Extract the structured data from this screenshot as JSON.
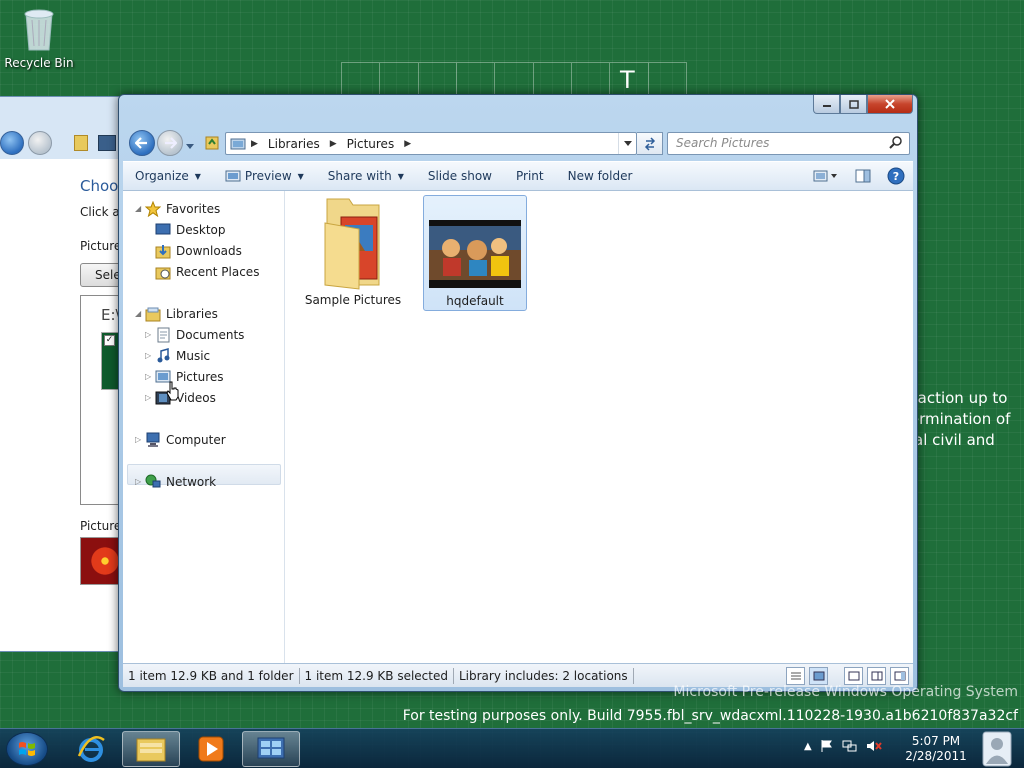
{
  "desktop": {
    "recycle_bin_label": "Recycle Bin",
    "grid_letter": "T",
    "right_text": [
      "y action up to",
      "termination of",
      "tial civil and"
    ],
    "build_line1": "Microsoft Pre-release Windows Operating System",
    "build_line2": "For testing purposes only. Build 7955.fbl_srv_wdacxml.110228-1930.a1b6210f837a32cf"
  },
  "bg_window": {
    "title": "Choos",
    "click_text": "Click a p",
    "picture_loc": "Picture l",
    "select_btn": "Sele",
    "drive_text": "E:\\U",
    "checkbox": "✓",
    "picture_pos": "Picture p"
  },
  "explorer": {
    "breadcrumbs": [
      "Libraries",
      "Pictures"
    ],
    "search_placeholder": "Search Pictures",
    "toolbar": {
      "organize": "Organize",
      "preview": "Preview",
      "share_with": "Share with",
      "slide_show": "Slide show",
      "print": "Print",
      "new_folder": "New folder"
    },
    "nav": {
      "favorites": "Favorites",
      "desktop": "Desktop",
      "downloads": "Downloads",
      "recent_places": "Recent Places",
      "libraries": "Libraries",
      "documents": "Documents",
      "music": "Music",
      "pictures": "Pictures",
      "videos": "Videos",
      "computer": "Computer",
      "network": "Network"
    },
    "files": [
      {
        "name": "Sample Pictures",
        "type": "folder"
      },
      {
        "name": "hqdefault",
        "type": "image",
        "selected": true
      }
    ],
    "status": {
      "items": "1 item 12.9 KB and 1 folder",
      "selected": "1 item 12.9 KB selected",
      "library": "Library includes:  2 locations"
    }
  },
  "taskbar": {
    "time": "5:07 PM",
    "date": "2/28/2011"
  }
}
